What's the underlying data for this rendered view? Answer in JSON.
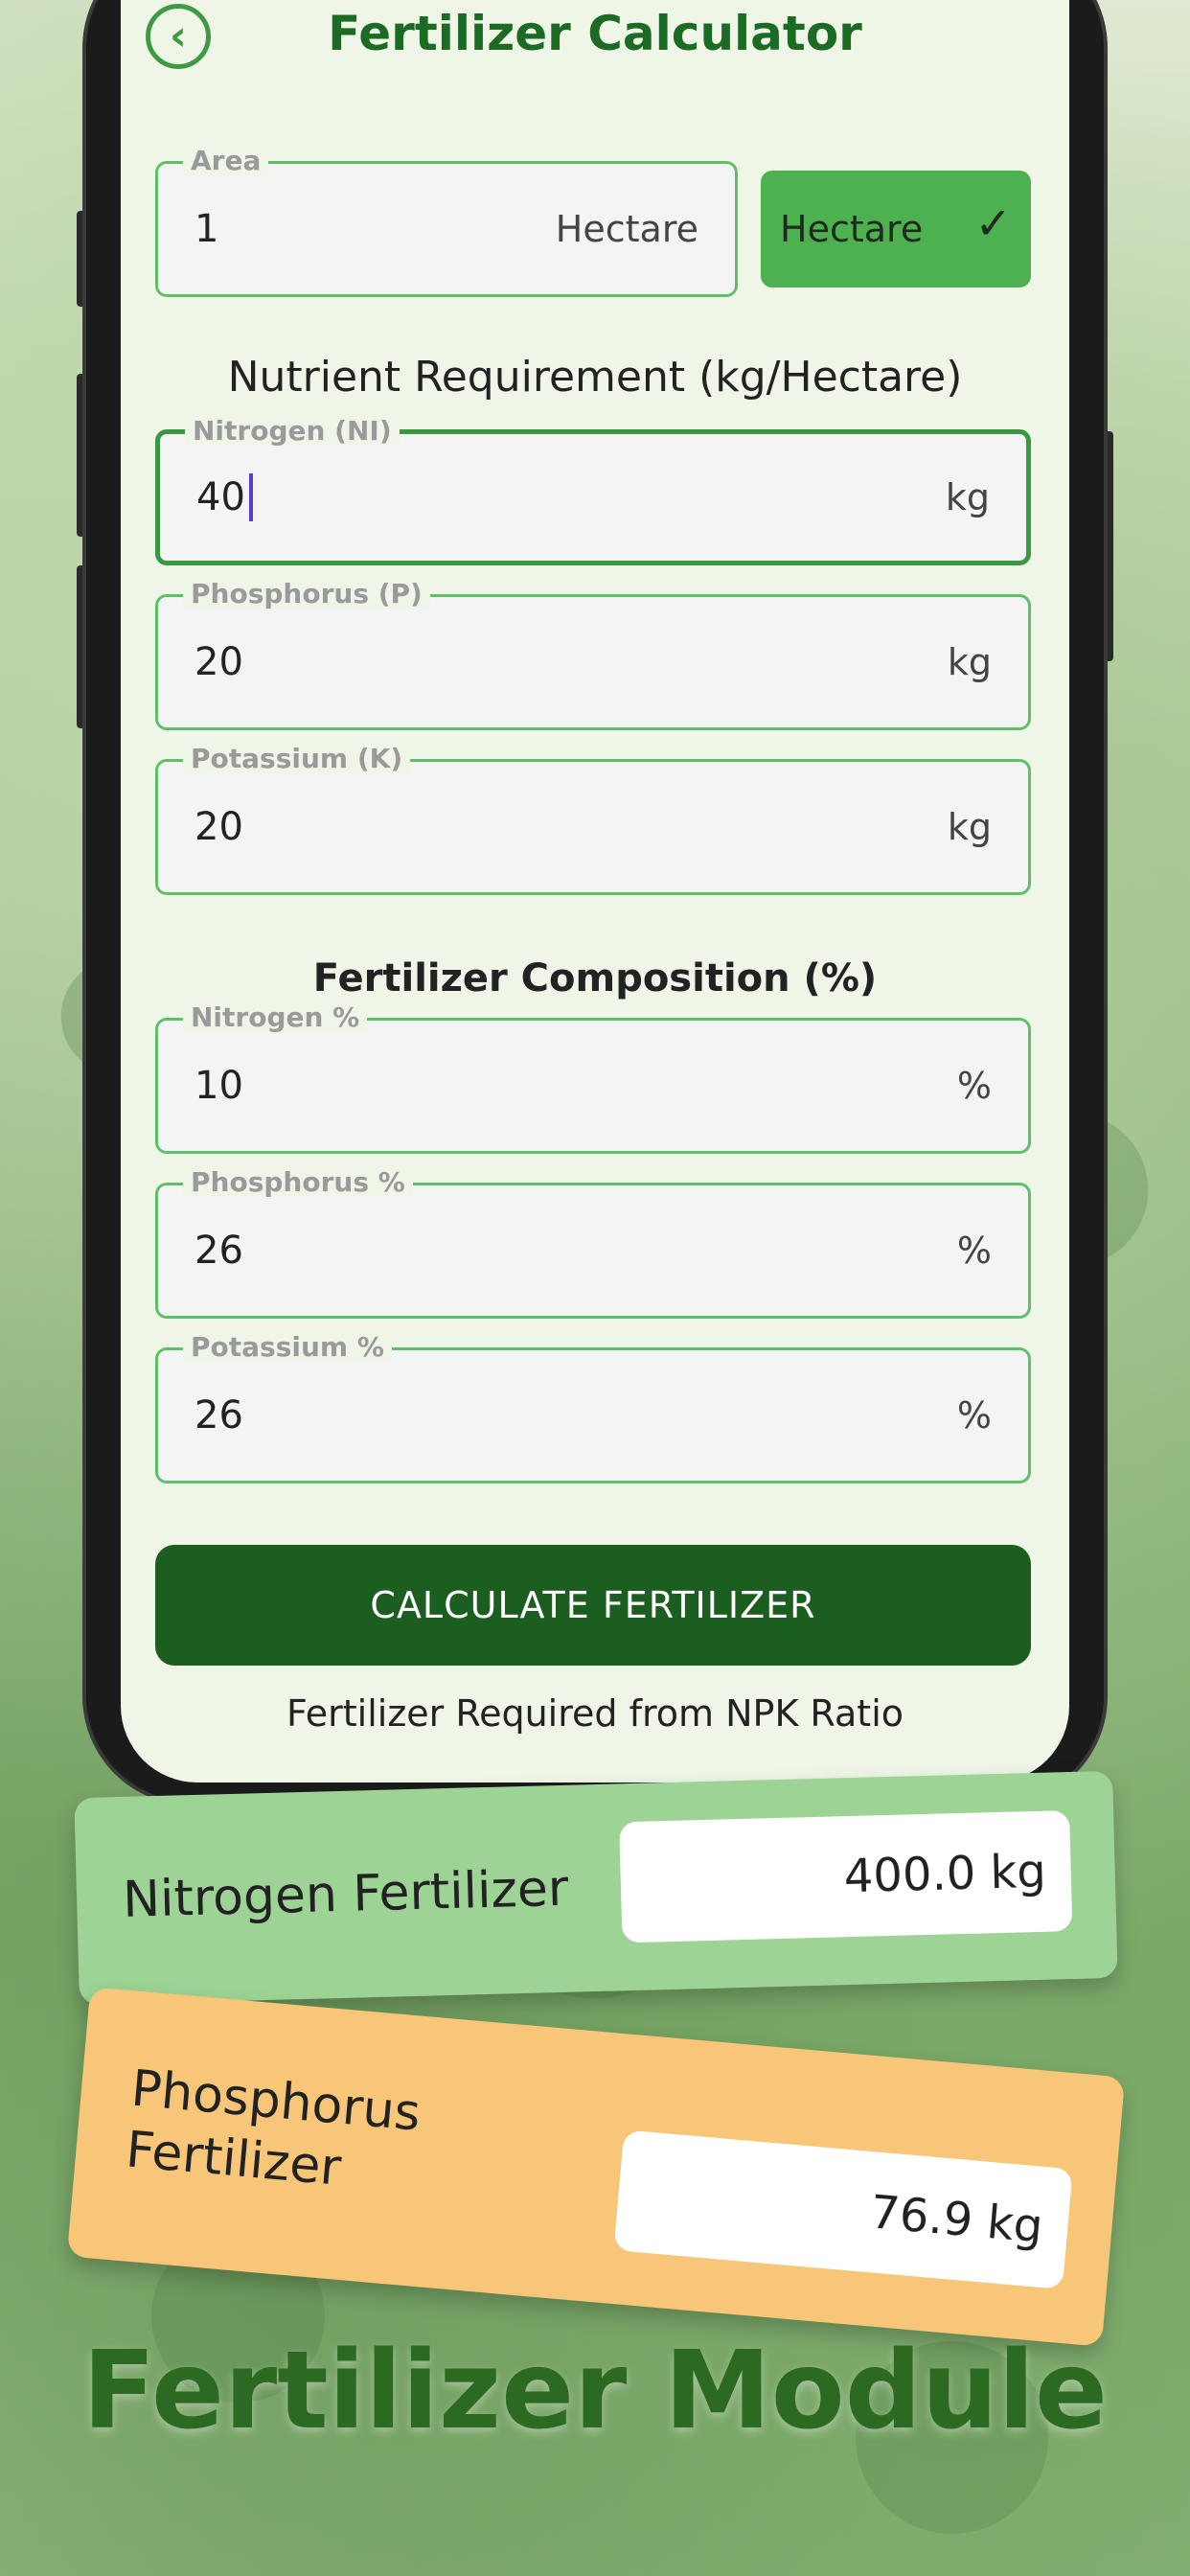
{
  "header": {
    "title": "Fertilizer Calculator"
  },
  "area": {
    "label": "Area",
    "value": "1",
    "unit": "Hectare"
  },
  "unit_select": {
    "selected": "Hectare"
  },
  "nutrient": {
    "title": "Nutrient Requirement (kg/Hectare)",
    "fields": [
      {
        "label": "Nitrogen (NI)",
        "value": "40",
        "unit": "kg"
      },
      {
        "label": "Phosphorus (P)",
        "value": "20",
        "unit": "kg"
      },
      {
        "label": "Potassium (K)",
        "value": "20",
        "unit": "kg"
      }
    ]
  },
  "composition": {
    "title": "Fertilizer Composition (%)",
    "fields": [
      {
        "label": "Nitrogen %",
        "value": "10",
        "unit": "%"
      },
      {
        "label": "Phosphorus %",
        "value": "26",
        "unit": "%"
      },
      {
        "label": "Potassium %",
        "value": "26",
        "unit": "%"
      }
    ]
  },
  "calculate_button": "CALCULATE FERTILIZER",
  "results": {
    "title": "Fertilizer Required from NPK Ratio",
    "nitrogen": {
      "label": "Nitrogen Fertilizer",
      "value": "400.0 kg"
    },
    "phosphorus": {
      "label_line1": "Phosphorus",
      "label_line2": "Fertilizer",
      "value": "76.9 kg"
    }
  },
  "module_title": "Fertilizer Module",
  "colors": {
    "primary_green": "#1c5e20",
    "accent_green": "#4db14f",
    "orange": "#f7c678",
    "light_green": "#9dd495"
  },
  "icons": {
    "back": "chevron-left-circle-icon",
    "dropdown": "chevron-down-icon"
  }
}
